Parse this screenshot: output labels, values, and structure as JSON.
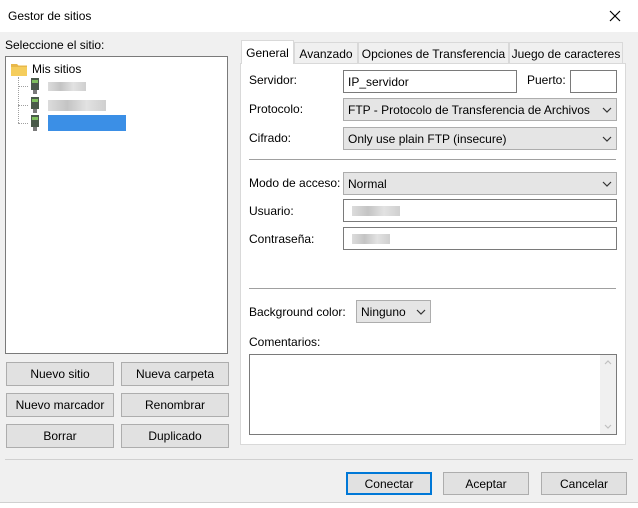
{
  "window": {
    "title": "Gestor de sitios"
  },
  "left": {
    "select_label": "Seleccione el sitio:",
    "tree_root": "Mis sitios",
    "buttons": {
      "new_site": "Nuevo sitio",
      "new_folder": "Nueva carpeta",
      "new_bookmark": "Nuevo marcador",
      "rename": "Renombrar",
      "delete": "Borrar",
      "duplicate": "Duplicado"
    }
  },
  "tabs": [
    "General",
    "Avanzado",
    "Opciones de Transferencia",
    "Juego de caracteres"
  ],
  "general": {
    "server_label": "Servidor:",
    "server_value": "IP_servidor",
    "port_label": "Puerto:",
    "port_value": "",
    "protocol_label": "Protocolo:",
    "protocol_value": "FTP - Protocolo de Transferencia de Archivos",
    "encryption_label": "Cifrado:",
    "encryption_value": "Only use plain FTP (insecure)",
    "access_label": "Modo de acceso:",
    "access_value": "Normal",
    "user_label": "Usuario:",
    "password_label": "Contraseña:",
    "bg_color_label": "Background color:",
    "bg_color_value": "Ninguno",
    "comments_label": "Comentarios:"
  },
  "footer": {
    "connect": "Conectar",
    "accept": "Aceptar",
    "cancel": "Cancelar"
  },
  "colors": {
    "accent": "#0078d7",
    "selection": "#3b8fe6",
    "folder": "#e8b84a"
  }
}
